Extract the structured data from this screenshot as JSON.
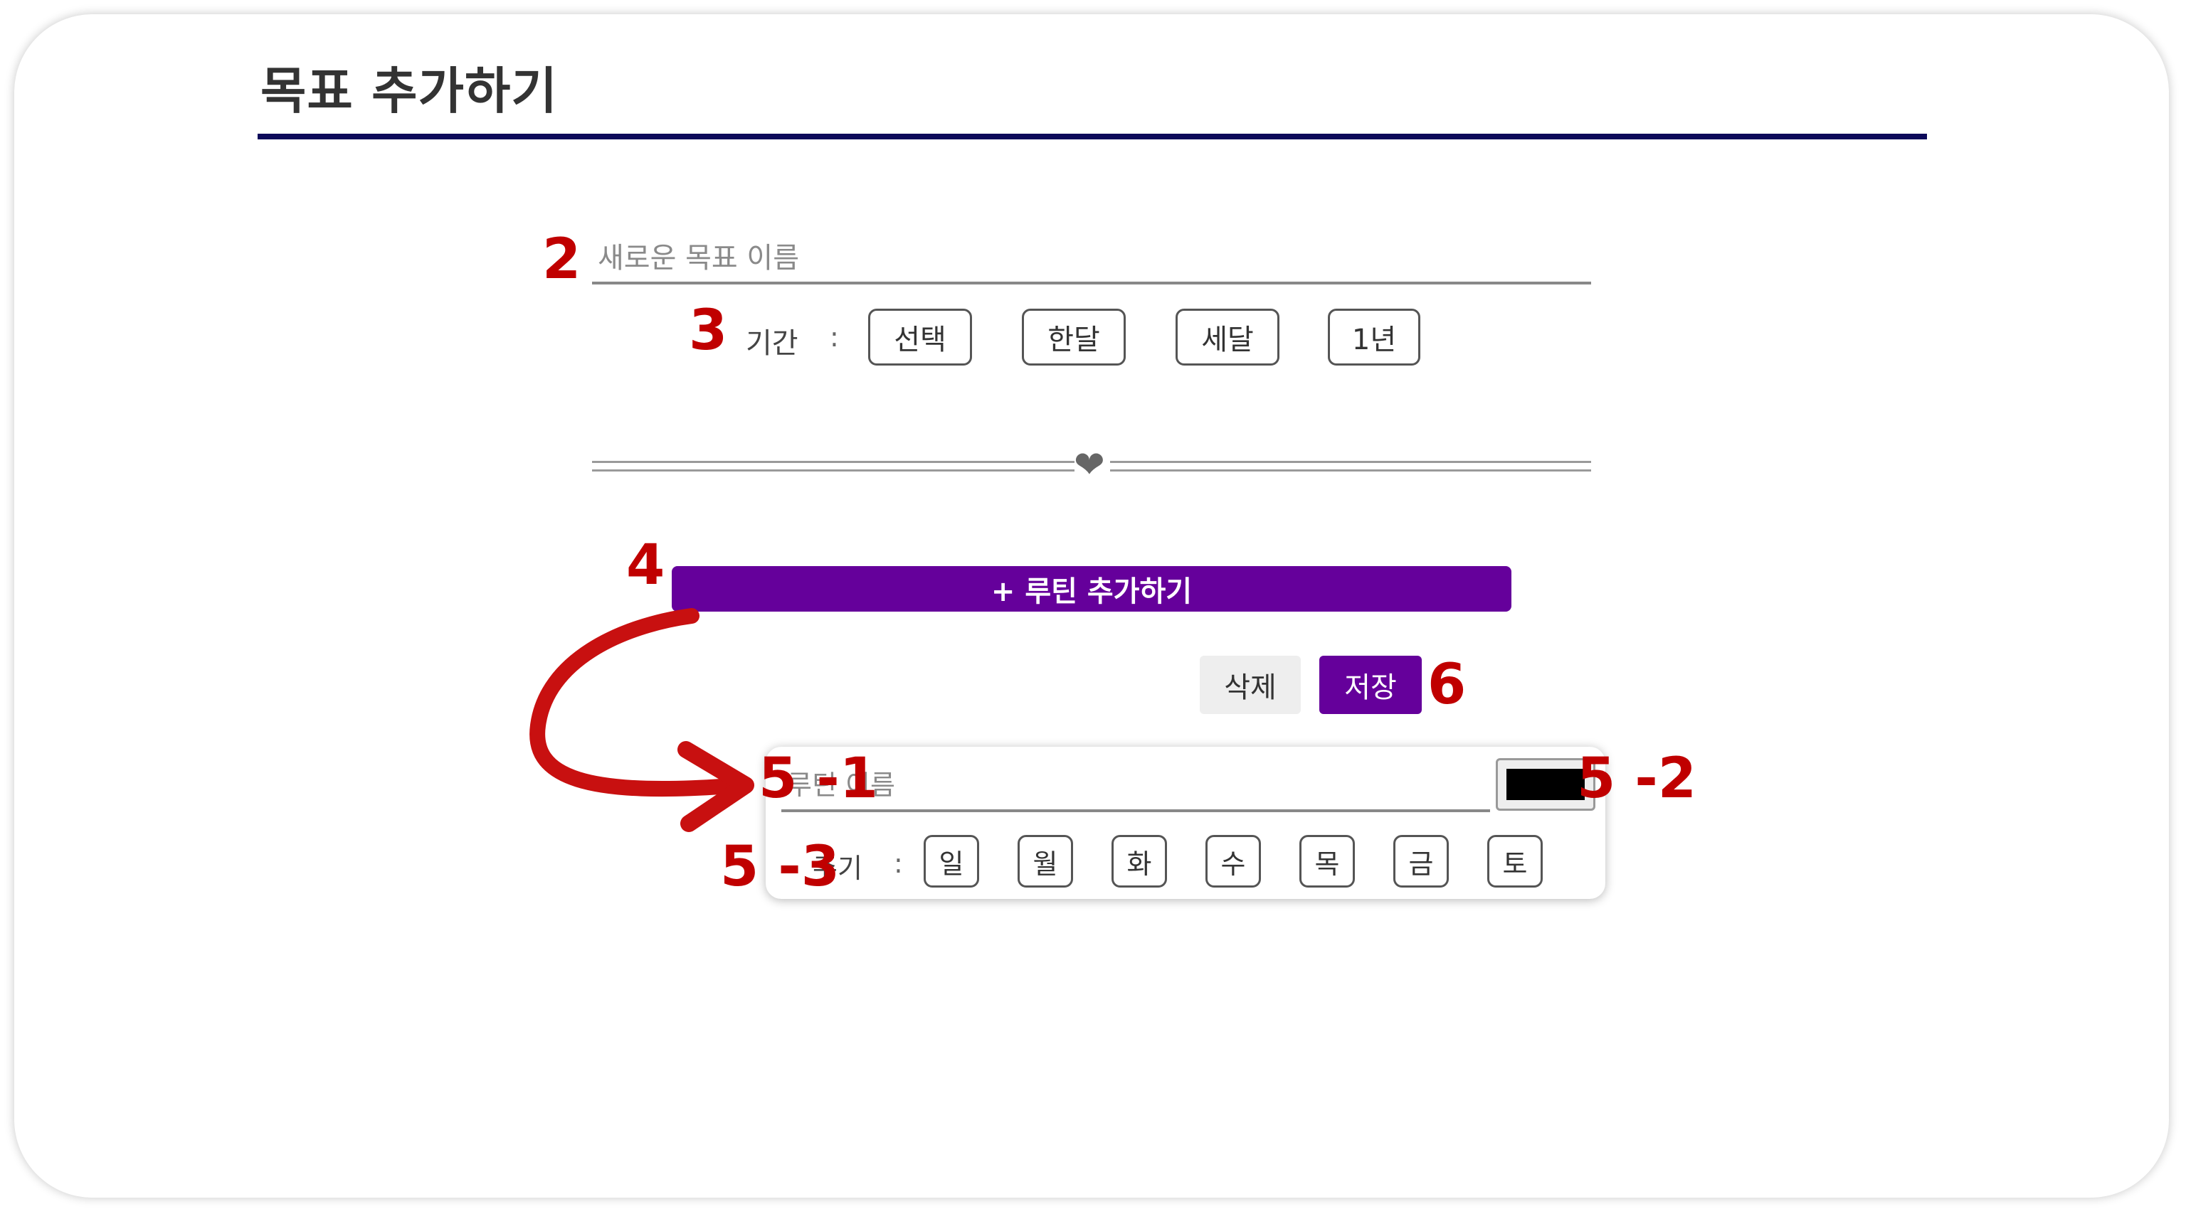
{
  "page": {
    "title": "목표 추가하기"
  },
  "goal": {
    "name_placeholder": "새로운 목표 이름",
    "period_label": "기간",
    "colon": ":",
    "period_options": [
      "선택",
      "한달",
      "세달",
      "1년"
    ]
  },
  "divider": {
    "icon": "heart-icon"
  },
  "routine": {
    "add_button_label": "+ 루틴 추가하기",
    "name_placeholder": "루틴 이름",
    "color_value": "#000000",
    "cycle_label": "주기",
    "colon": ":",
    "days": [
      "일",
      "월",
      "화",
      "수",
      "목",
      "금",
      "토"
    ]
  },
  "actions": {
    "delete_label": "삭제",
    "save_label": "저장"
  },
  "annotations": {
    "a2": "2",
    "a3": "3",
    "a4": "4",
    "a5_1": "5 -1",
    "a5_2": "5 -2",
    "a5_3": "5 -3",
    "a6": "6"
  },
  "colors": {
    "accent": "#65009b",
    "title_rule": "#0d0a5a",
    "annotation": "#c00000",
    "arrow": "#c81010"
  }
}
